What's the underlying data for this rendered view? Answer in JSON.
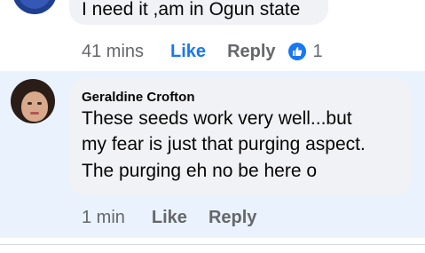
{
  "previous_comment": {
    "text": "I need it ,am in Ogun state",
    "time": "41 mins",
    "like_label": "Like",
    "reply_label": "Reply",
    "reaction": "like-icon",
    "reaction_count": "1"
  },
  "reply": {
    "author": "Geraldine Crofton",
    "text_lines": [
      "These seeds work very well...but",
      "my fear is just that purging aspect.",
      "The purging eh no be here o"
    ],
    "time": "1 min",
    "like_label": "Like",
    "reply_label": "Reply",
    "highlight_color": "#eaf2fd"
  },
  "colors": {
    "accent": "#1877f2",
    "secondary_text": "#65676b",
    "bubble": "#f0f2f5"
  }
}
